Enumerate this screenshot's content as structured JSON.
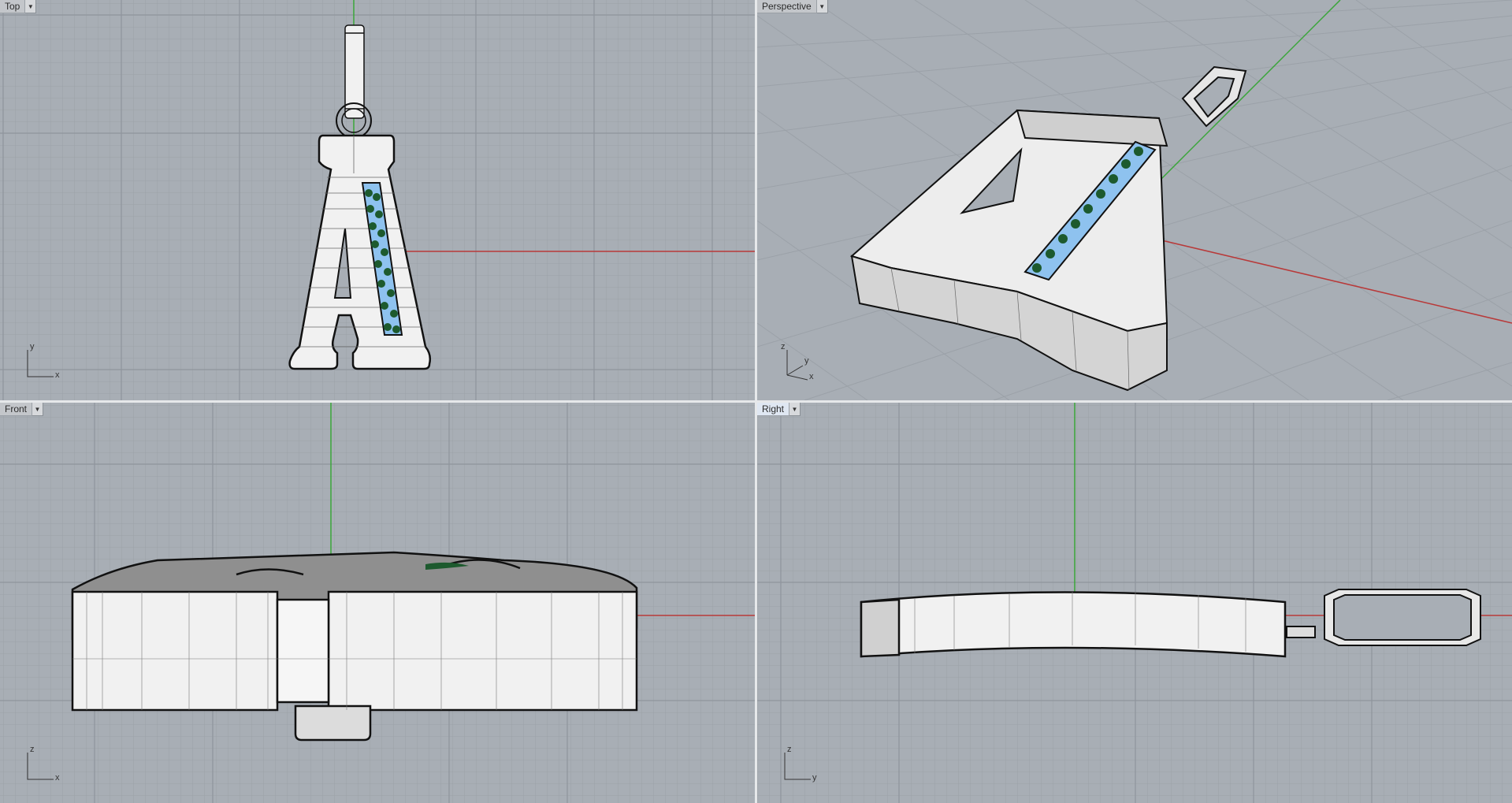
{
  "viewports": {
    "top": {
      "title": "Top",
      "axis_h": "x",
      "axis_v": "y"
    },
    "perspective": {
      "title": "Perspective",
      "axis_z": "z",
      "axis_y": "y",
      "axis_x": "x"
    },
    "front": {
      "title": "Front",
      "axis_h": "x",
      "axis_v": "z"
    },
    "right": {
      "title": "Right",
      "axis_h": "y",
      "axis_v": "z"
    }
  },
  "colors": {
    "viewport_bg": "#a8aeb5",
    "grid_minor": "#9ba1a8",
    "grid_major": "#8f959c",
    "x_axis": "#b83a3a",
    "y_axis": "#3aa53a",
    "model_fill": "#f1f1f1",
    "gem_blue": "#8ec2ef",
    "gem_green": "#1d5a2e"
  }
}
